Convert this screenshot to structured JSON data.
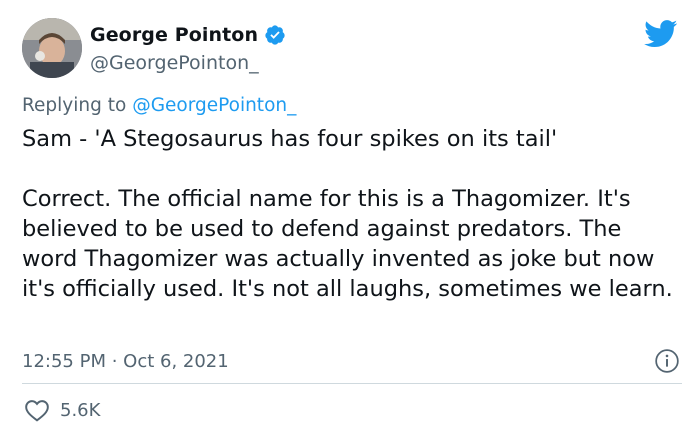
{
  "author": {
    "display_name": "George Pointon",
    "handle": "@GeorgePointon_",
    "verified": true
  },
  "reply": {
    "prefix": "Replying to ",
    "target": "@GeorgePointon_"
  },
  "tweet": {
    "line1": "Sam - 'A Stegosaurus has four spikes on its tail'",
    "para2": "Correct. The official name for this is a Thagomizer. It's believed to be used to defend against predators. The word Thagomizer was actually invented as joke but now it's officially used. It's not all laughs, sometimes we learn."
  },
  "meta": {
    "timestamp": "12:55 PM · Oct 6, 2021"
  },
  "engagement": {
    "likes": "5.6K"
  },
  "colors": {
    "accent": "#1d9bf0",
    "secondary_text": "#536471",
    "primary_text": "#0f1419",
    "divider": "#cfd9de"
  },
  "icons": [
    "verified-badge-icon",
    "twitter-bird-icon",
    "info-icon",
    "heart-icon"
  ]
}
